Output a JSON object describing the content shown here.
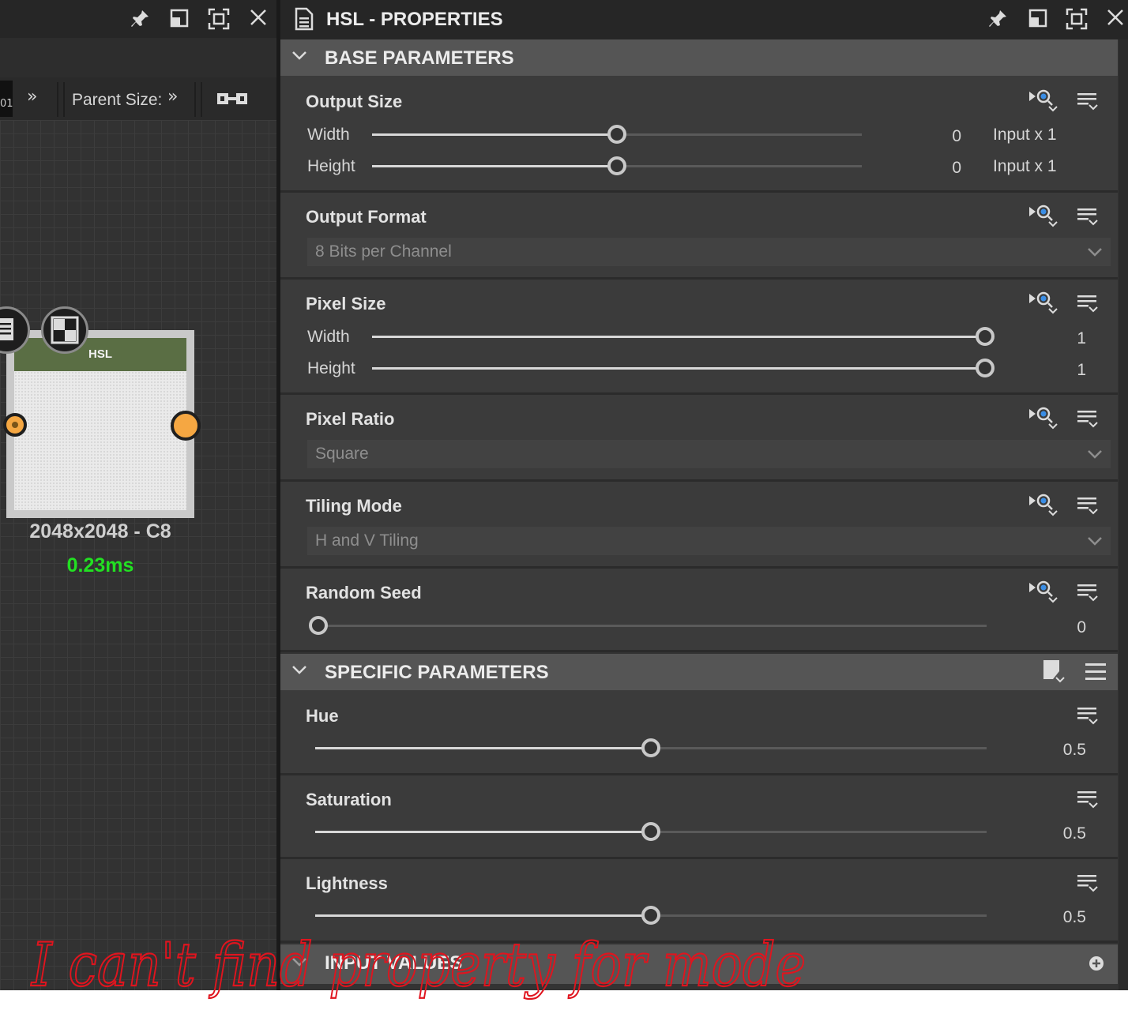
{
  "graph": {
    "toolbar": {
      "partial_text": "01",
      "more1": "»",
      "parent_size_label": "Parent Size:",
      "more2": "»"
    },
    "node": {
      "title": "HSL",
      "resolution": "2048x2048 - C8",
      "timing": "0.23ms"
    },
    "header_icons": [
      "pin-icon",
      "restore-icon",
      "maximize-icon",
      "close-icon"
    ]
  },
  "props": {
    "title": "HSL - PROPERTIES",
    "base_section": "BASE PARAMETERS",
    "output_size": {
      "title": "Output Size",
      "width_label": "Width",
      "width_value": "0",
      "width_unit": "Input x 1",
      "width_fraction": 0.5,
      "height_label": "Height",
      "height_value": "0",
      "height_unit": "Input x 1",
      "height_fraction": 0.5
    },
    "output_format": {
      "title": "Output Format",
      "value": "8 Bits per Channel"
    },
    "pixel_size": {
      "title": "Pixel Size",
      "width_label": "Width",
      "width_value": "1",
      "width_fraction": 1.0,
      "height_label": "Height",
      "height_value": "1",
      "height_fraction": 1.0
    },
    "pixel_ratio": {
      "title": "Pixel Ratio",
      "value": "Square"
    },
    "tiling_mode": {
      "title": "Tiling Mode",
      "value": "H and V Tiling"
    },
    "random_seed": {
      "title": "Random Seed",
      "value": "0",
      "fraction": 0.0
    },
    "specific_section": "SPECIFIC PARAMETERS",
    "hue": {
      "title": "Hue",
      "value": "0.5",
      "fraction": 0.5
    },
    "saturation": {
      "title": "Saturation",
      "value": "0.5",
      "fraction": 0.5
    },
    "lightness": {
      "title": "Lightness",
      "value": "0.5",
      "fraction": 0.5
    },
    "input_section": "INPUT VALUES"
  },
  "annotation": {
    "text": "I can't find property for mode",
    "color": "#e0141e"
  },
  "colors": {
    "accent_port": "#f5a742",
    "node_header": "#5a6e44",
    "timing_green": "#22e022",
    "panel_bg": "#333333"
  }
}
